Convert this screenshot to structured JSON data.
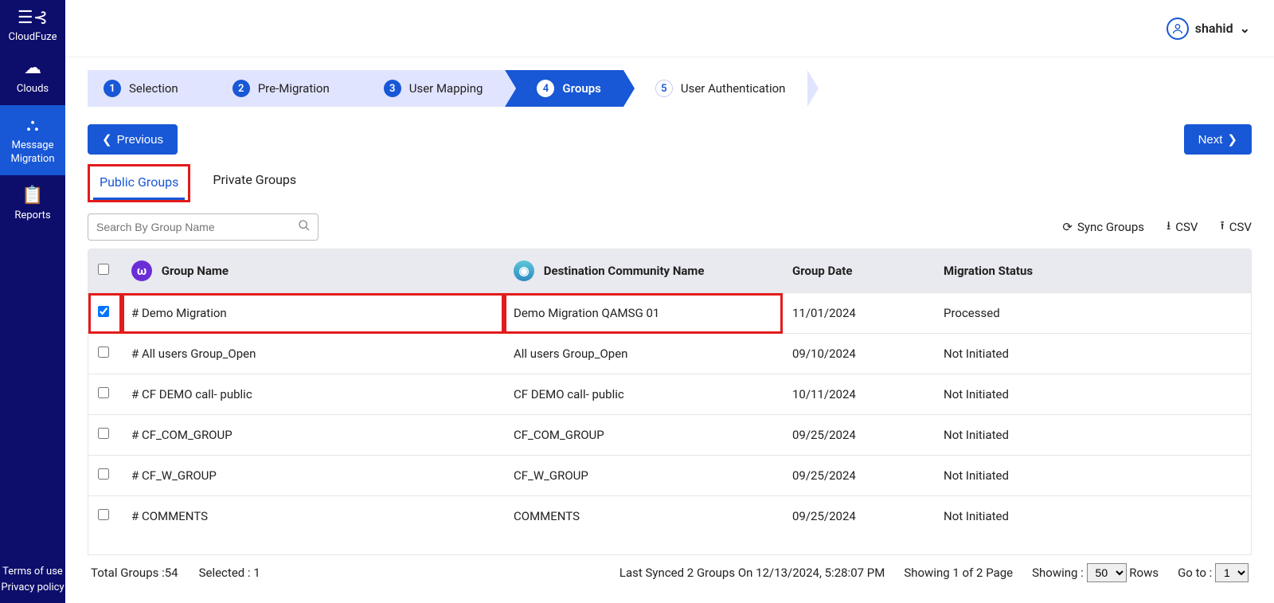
{
  "sidebar": {
    "brand": "CloudFuze",
    "items": [
      {
        "icon": "☁",
        "label": "Clouds"
      },
      {
        "icon": "⇄",
        "label": "Message Migration"
      },
      {
        "icon": "📋",
        "label": "Reports"
      }
    ],
    "footer1": "Terms of use",
    "footer2": "Privacy policy"
  },
  "topbar": {
    "username": "shahid"
  },
  "steps": [
    {
      "num": "1",
      "label": "Selection"
    },
    {
      "num": "2",
      "label": "Pre-Migration"
    },
    {
      "num": "3",
      "label": "User Mapping"
    },
    {
      "num": "4",
      "label": "Groups"
    },
    {
      "num": "5",
      "label": "User Authentication"
    }
  ],
  "buttons": {
    "previous": "Previous",
    "next": "Next"
  },
  "tabs": {
    "public": "Public Groups",
    "private": "Private Groups"
  },
  "search": {
    "placeholder": "Search By Group Name"
  },
  "toolbar": {
    "sync": "Sync Groups",
    "csv_down": "CSV",
    "csv_up": "CSV"
  },
  "columns": {
    "group_name": "Group Name",
    "dest": "Destination Community Name",
    "date": "Group Date",
    "status": "Migration Status"
  },
  "rows": [
    {
      "checked": true,
      "name": "# Demo Migration",
      "dest": "Demo Migration QAMSG 01",
      "date": "11/01/2024",
      "status": "Processed",
      "highlight": true
    },
    {
      "checked": false,
      "name": "# All users Group_Open",
      "dest": "All users Group_Open",
      "date": "09/10/2024",
      "status": "Not Initiated"
    },
    {
      "checked": false,
      "name": "# CF DEMO call- public",
      "dest": "CF DEMO call- public",
      "date": "10/11/2024",
      "status": "Not Initiated"
    },
    {
      "checked": false,
      "name": "# CF_COM_GROUP",
      "dest": "CF_COM_GROUP",
      "date": "09/25/2024",
      "status": "Not Initiated"
    },
    {
      "checked": false,
      "name": "# CF_W_GROUP",
      "dest": "CF_W_GROUP",
      "date": "09/25/2024",
      "status": "Not Initiated"
    },
    {
      "checked": false,
      "name": "# COMMENTS",
      "dest": "COMMENTS",
      "date": "09/25/2024",
      "status": "Not Initiated"
    }
  ],
  "footer": {
    "total_label": "Total Groups :",
    "total_value": "54",
    "selected_label": "Selected :",
    "selected_value": "1",
    "synced": "Last Synced 2 Groups On 12/13/2024, 5:28:07 PM",
    "pages": "Showing 1 of 2 Page",
    "showing_label": "Showing :",
    "showing_value": "50",
    "rows_label": "Rows",
    "goto_label": "Go to :",
    "goto_value": "1"
  }
}
